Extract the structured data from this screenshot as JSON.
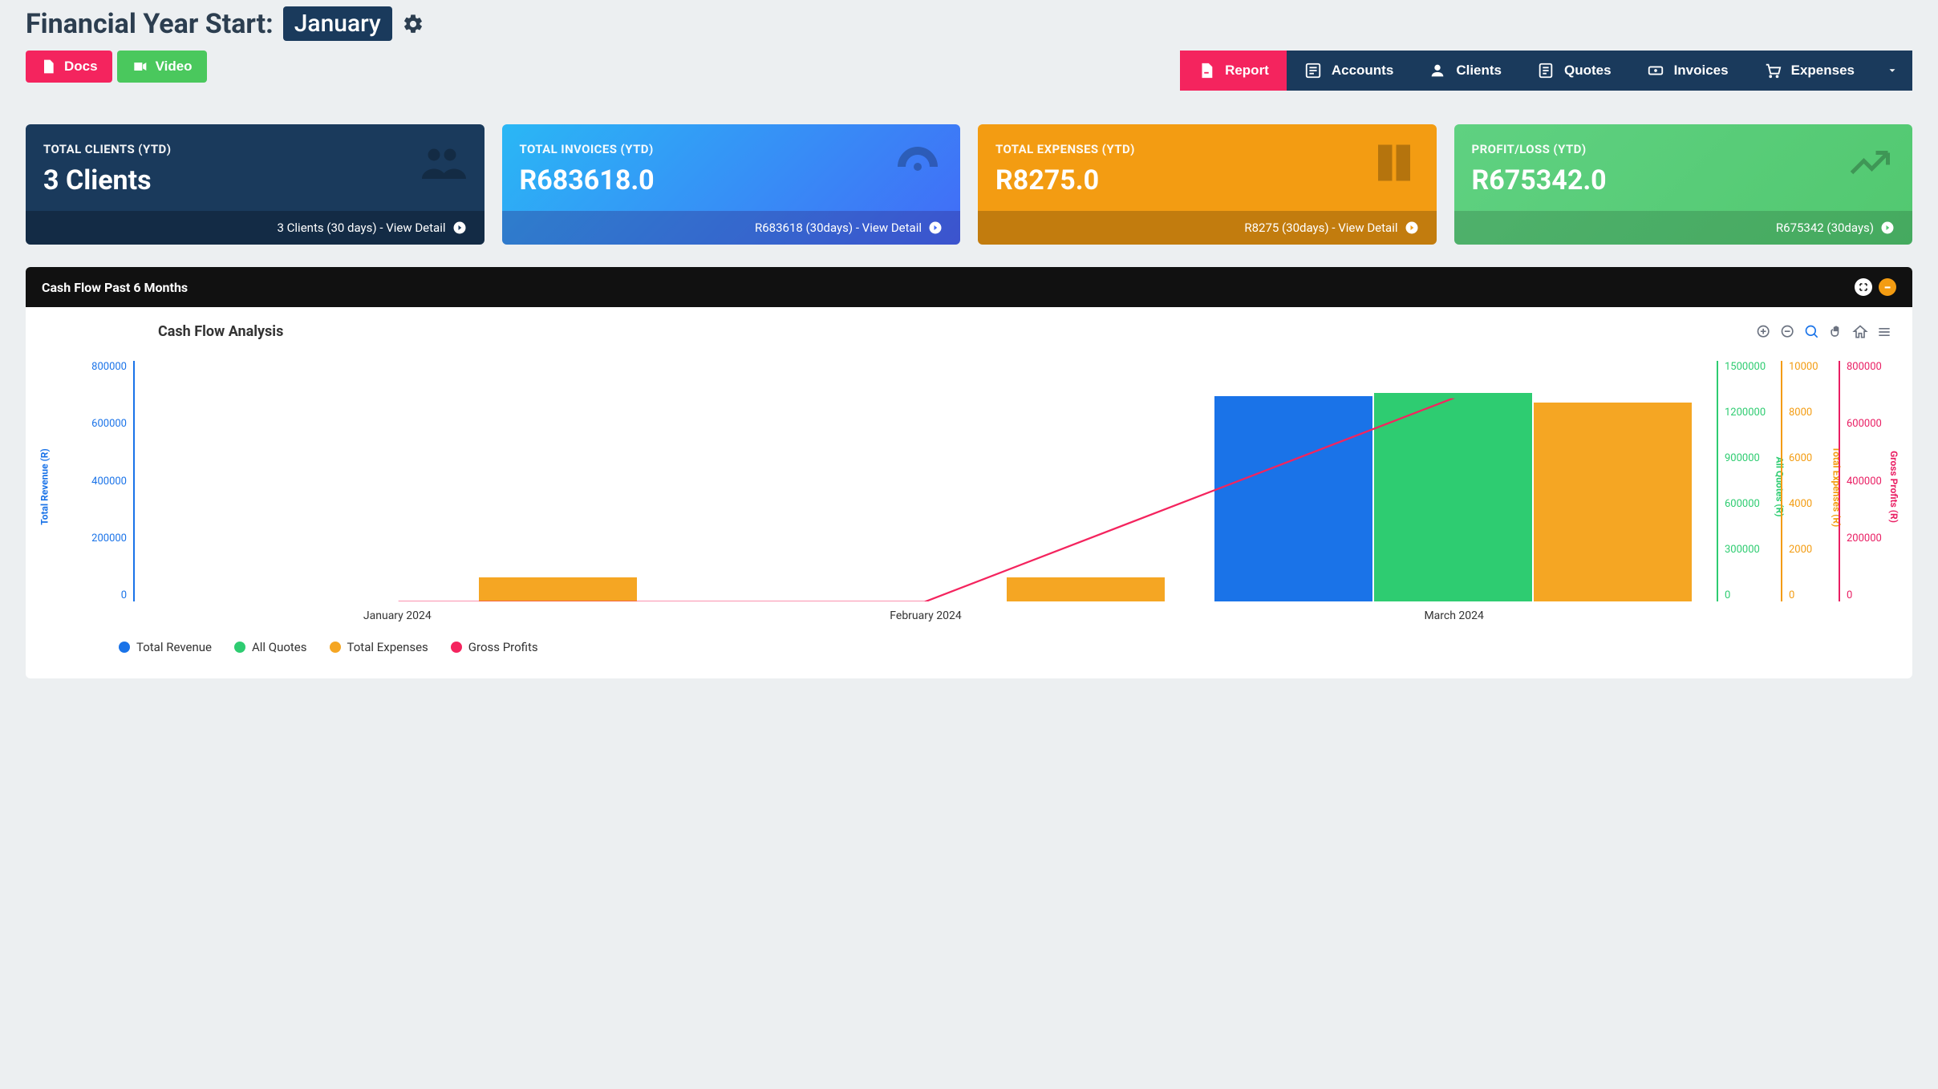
{
  "header": {
    "fy_label": "Financial Year Start:",
    "fy_value": "January"
  },
  "buttons": {
    "docs": "Docs",
    "video": "Video"
  },
  "nav": [
    {
      "id": "report",
      "label": "Report",
      "active": true
    },
    {
      "id": "accounts",
      "label": "Accounts",
      "active": false
    },
    {
      "id": "clients",
      "label": "Clients",
      "active": false
    },
    {
      "id": "quotes",
      "label": "Quotes",
      "active": false
    },
    {
      "id": "invoices",
      "label": "Invoices",
      "active": false
    },
    {
      "id": "expenses",
      "label": "Expenses",
      "active": false
    }
  ],
  "cards": {
    "clients": {
      "title": "TOTAL CLIENTS (YTD)",
      "value": "3 Clients",
      "foot": "3 Clients (30 days) - View Detail"
    },
    "invoices": {
      "title": "TOTAL INVOICES (YTD)",
      "value": "R683618.0",
      "foot": "R683618 (30days) - View Detail"
    },
    "expenses": {
      "title": "TOTAL EXPENSES (YTD)",
      "value": "R8275.0",
      "foot": "R8275 (30days) - View Detail"
    },
    "profit": {
      "title": "PROFIT/LOSS (YTD)",
      "value": "R675342.0",
      "foot": "R675342 (30days)"
    }
  },
  "chart_panel": {
    "header": "Cash Flow Past 6 Months",
    "title": "Cash Flow Analysis"
  },
  "axes": {
    "left": {
      "label": "Total Revenue (R)",
      "ticks": [
        "800000",
        "600000",
        "400000",
        "200000",
        "0"
      ]
    },
    "r1": {
      "label": "All Quotes (R)",
      "ticks": [
        "1500000",
        "1200000",
        "900000",
        "600000",
        "300000",
        "0"
      ]
    },
    "r2": {
      "label": "Total Expenses (R)",
      "ticks": [
        "10000",
        "8000",
        "6000",
        "4000",
        "2000",
        "0"
      ]
    },
    "r3": {
      "label": "Gross Profits (R)",
      "ticks": [
        "800000",
        "600000",
        "400000",
        "200000",
        "0"
      ]
    }
  },
  "legend": {
    "revenue": "Total Revenue",
    "quotes": "All Quotes",
    "expenses": "Total Expenses",
    "profits": "Gross Profits"
  },
  "x_labels": [
    "January 2024",
    "February 2024",
    "March 2024"
  ],
  "colors": {
    "blue": "#1a73e8",
    "green": "#2ecc71",
    "orange": "#f5a623",
    "pink": "#f4245e"
  },
  "chart_data": {
    "type": "bar",
    "categories": [
      "January 2024",
      "February 2024",
      "March 2024"
    ],
    "series": [
      {
        "name": "Total Revenue",
        "axis": "left",
        "values": [
          0,
          0,
          683618
        ],
        "color": "#1a73e8"
      },
      {
        "name": "All Quotes",
        "axis": "r1",
        "values": [
          0,
          0,
          1300000
        ],
        "color": "#2ecc71"
      },
      {
        "name": "Total Expenses",
        "axis": "r2",
        "values": [
          1000,
          1000,
          8275
        ],
        "color": "#f5a623"
      },
      {
        "name": "Gross Profits",
        "axis": "r3",
        "type": "line",
        "values": [
          0,
          0,
          675342
        ],
        "color": "#f4245e"
      }
    ],
    "axes": {
      "left": {
        "label": "Total Revenue (R)",
        "range": [
          0,
          800000
        ]
      },
      "r1": {
        "label": "All Quotes (R)",
        "range": [
          0,
          1500000
        ]
      },
      "r2": {
        "label": "Total Expenses (R)",
        "range": [
          0,
          10000
        ]
      },
      "r3": {
        "label": "Gross Profits (R)",
        "range": [
          0,
          800000
        ]
      }
    },
    "title": "Cash Flow Analysis"
  }
}
